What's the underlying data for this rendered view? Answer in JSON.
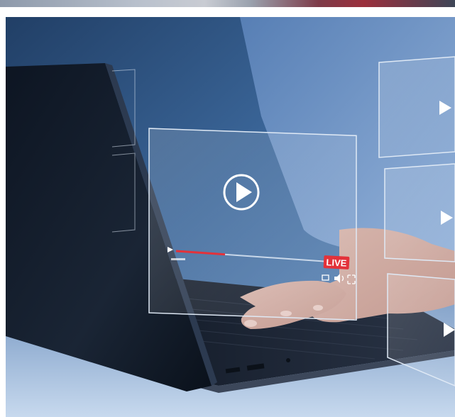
{
  "overlay": {
    "live_label": "LIVE"
  },
  "icons": [
    "play-icon",
    "volume-icon",
    "fullscreen-icon",
    "settings-icon"
  ],
  "colors": {
    "live_badge": "#e3323a",
    "progress": "#e3323a",
    "overlay_line": "#dfe9f5"
  },
  "player": {
    "progress_fraction": 0.3
  }
}
